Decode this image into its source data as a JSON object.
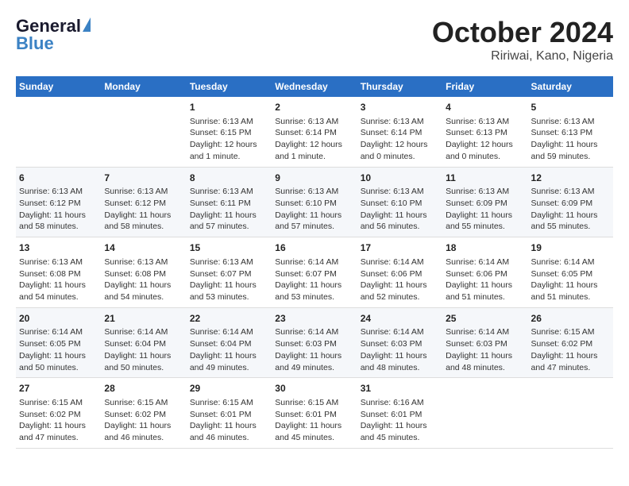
{
  "header": {
    "logo_general": "General",
    "logo_blue": "Blue",
    "title": "October 2024",
    "subtitle": "Ririwai, Kano, Nigeria"
  },
  "columns": [
    "Sunday",
    "Monday",
    "Tuesday",
    "Wednesday",
    "Thursday",
    "Friday",
    "Saturday"
  ],
  "rows": [
    [
      {
        "day": "",
        "text": ""
      },
      {
        "day": "",
        "text": ""
      },
      {
        "day": "1",
        "text": "Sunrise: 6:13 AM\nSunset: 6:15 PM\nDaylight: 12 hours and 1 minute."
      },
      {
        "day": "2",
        "text": "Sunrise: 6:13 AM\nSunset: 6:14 PM\nDaylight: 12 hours and 1 minute."
      },
      {
        "day": "3",
        "text": "Sunrise: 6:13 AM\nSunset: 6:14 PM\nDaylight: 12 hours and 0 minutes."
      },
      {
        "day": "4",
        "text": "Sunrise: 6:13 AM\nSunset: 6:13 PM\nDaylight: 12 hours and 0 minutes."
      },
      {
        "day": "5",
        "text": "Sunrise: 6:13 AM\nSunset: 6:13 PM\nDaylight: 11 hours and 59 minutes."
      }
    ],
    [
      {
        "day": "6",
        "text": "Sunrise: 6:13 AM\nSunset: 6:12 PM\nDaylight: 11 hours and 58 minutes."
      },
      {
        "day": "7",
        "text": "Sunrise: 6:13 AM\nSunset: 6:12 PM\nDaylight: 11 hours and 58 minutes."
      },
      {
        "day": "8",
        "text": "Sunrise: 6:13 AM\nSunset: 6:11 PM\nDaylight: 11 hours and 57 minutes."
      },
      {
        "day": "9",
        "text": "Sunrise: 6:13 AM\nSunset: 6:10 PM\nDaylight: 11 hours and 57 minutes."
      },
      {
        "day": "10",
        "text": "Sunrise: 6:13 AM\nSunset: 6:10 PM\nDaylight: 11 hours and 56 minutes."
      },
      {
        "day": "11",
        "text": "Sunrise: 6:13 AM\nSunset: 6:09 PM\nDaylight: 11 hours and 55 minutes."
      },
      {
        "day": "12",
        "text": "Sunrise: 6:13 AM\nSunset: 6:09 PM\nDaylight: 11 hours and 55 minutes."
      }
    ],
    [
      {
        "day": "13",
        "text": "Sunrise: 6:13 AM\nSunset: 6:08 PM\nDaylight: 11 hours and 54 minutes."
      },
      {
        "day": "14",
        "text": "Sunrise: 6:13 AM\nSunset: 6:08 PM\nDaylight: 11 hours and 54 minutes."
      },
      {
        "day": "15",
        "text": "Sunrise: 6:13 AM\nSunset: 6:07 PM\nDaylight: 11 hours and 53 minutes."
      },
      {
        "day": "16",
        "text": "Sunrise: 6:14 AM\nSunset: 6:07 PM\nDaylight: 11 hours and 53 minutes."
      },
      {
        "day": "17",
        "text": "Sunrise: 6:14 AM\nSunset: 6:06 PM\nDaylight: 11 hours and 52 minutes."
      },
      {
        "day": "18",
        "text": "Sunrise: 6:14 AM\nSunset: 6:06 PM\nDaylight: 11 hours and 51 minutes."
      },
      {
        "day": "19",
        "text": "Sunrise: 6:14 AM\nSunset: 6:05 PM\nDaylight: 11 hours and 51 minutes."
      }
    ],
    [
      {
        "day": "20",
        "text": "Sunrise: 6:14 AM\nSunset: 6:05 PM\nDaylight: 11 hours and 50 minutes."
      },
      {
        "day": "21",
        "text": "Sunrise: 6:14 AM\nSunset: 6:04 PM\nDaylight: 11 hours and 50 minutes."
      },
      {
        "day": "22",
        "text": "Sunrise: 6:14 AM\nSunset: 6:04 PM\nDaylight: 11 hours and 49 minutes."
      },
      {
        "day": "23",
        "text": "Sunrise: 6:14 AM\nSunset: 6:03 PM\nDaylight: 11 hours and 49 minutes."
      },
      {
        "day": "24",
        "text": "Sunrise: 6:14 AM\nSunset: 6:03 PM\nDaylight: 11 hours and 48 minutes."
      },
      {
        "day": "25",
        "text": "Sunrise: 6:14 AM\nSunset: 6:03 PM\nDaylight: 11 hours and 48 minutes."
      },
      {
        "day": "26",
        "text": "Sunrise: 6:15 AM\nSunset: 6:02 PM\nDaylight: 11 hours and 47 minutes."
      }
    ],
    [
      {
        "day": "27",
        "text": "Sunrise: 6:15 AM\nSunset: 6:02 PM\nDaylight: 11 hours and 47 minutes."
      },
      {
        "day": "28",
        "text": "Sunrise: 6:15 AM\nSunset: 6:02 PM\nDaylight: 11 hours and 46 minutes."
      },
      {
        "day": "29",
        "text": "Sunrise: 6:15 AM\nSunset: 6:01 PM\nDaylight: 11 hours and 46 minutes."
      },
      {
        "day": "30",
        "text": "Sunrise: 6:15 AM\nSunset: 6:01 PM\nDaylight: 11 hours and 45 minutes."
      },
      {
        "day": "31",
        "text": "Sunrise: 6:16 AM\nSunset: 6:01 PM\nDaylight: 11 hours and 45 minutes."
      },
      {
        "day": "",
        "text": ""
      },
      {
        "day": "",
        "text": ""
      }
    ]
  ]
}
